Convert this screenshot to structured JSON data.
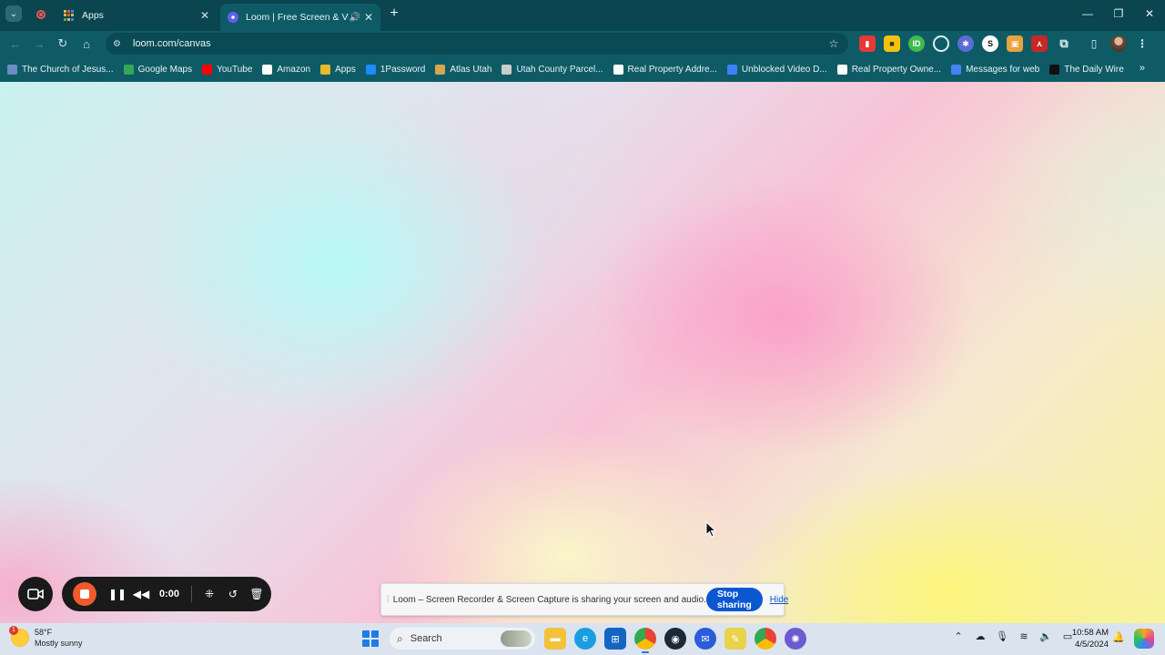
{
  "browser": {
    "tabs": [
      {
        "title": "Apps",
        "favicon": "apps-grid-icon"
      },
      {
        "title": "Loom | Free Screen & Video Recording",
        "favicon": "loom-icon",
        "audio": true
      }
    ],
    "address": {
      "url": "loom.com/canvas"
    },
    "bookmarks": [
      {
        "label": "The Church of Jesus...",
        "icon": "church-icon",
        "color": "#6b8cc4"
      },
      {
        "label": "Google Maps",
        "icon": "maps-pin-icon",
        "color": "#34a853"
      },
      {
        "label": "YouTube",
        "icon": "youtube-icon",
        "color": "#ff0000"
      },
      {
        "label": "Amazon",
        "icon": "amazon-icon",
        "color": "#ffffff"
      },
      {
        "label": "Apps",
        "icon": "apps-grid-icon",
        "color": "#e8b830"
      },
      {
        "label": "1Password",
        "icon": "onepassword-icon",
        "color": "#1a8cff"
      },
      {
        "label": "Atlas Utah",
        "icon": "atlas-icon",
        "color": "#d4a84b"
      },
      {
        "label": "Utah County Parcel...",
        "icon": "globe-icon",
        "color": "#cccccc"
      },
      {
        "label": "Real Property Addre...",
        "icon": "page-icon",
        "color": "#ffffff"
      },
      {
        "label": "Unblocked Video D...",
        "icon": "video-icon",
        "color": "#3b82f6"
      },
      {
        "label": "Real Property Owne...",
        "icon": "page-icon",
        "color": "#ffffff"
      },
      {
        "label": "Messages for web",
        "icon": "messages-icon",
        "color": "#4285f4"
      },
      {
        "label": "The Daily Wire",
        "icon": "dailywire-icon",
        "color": "#111111"
      }
    ]
  },
  "loom": {
    "timer": "0:00"
  },
  "share_notice": {
    "text": "Loom – Screen Recorder & Screen Capture is sharing your screen and audio.",
    "stop_label": "Stop sharing",
    "hide_label": "Hide"
  },
  "taskbar": {
    "weather": {
      "temp": "58°F",
      "condition": "Mostly sunny",
      "badge": "1"
    },
    "search_placeholder": "Search",
    "time": "10:58 AM",
    "date": "4/5/2024"
  },
  "colors": {
    "chrome_frame": "#0a4550",
    "chrome_toolbar": "#0e5b66",
    "loom_stop": "#f05a2c",
    "share_button": "#0b57d0"
  }
}
